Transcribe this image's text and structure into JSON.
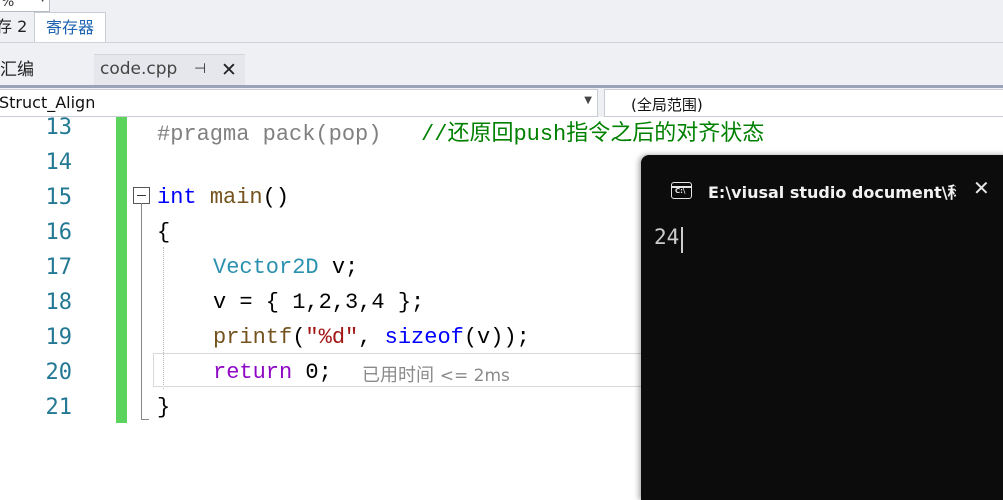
{
  "zoom": {
    "value": "%"
  },
  "window_tabs": [
    {
      "label": "存 2"
    },
    {
      "label": "寄存器"
    }
  ],
  "doc_tabs": {
    "left_label": "汇编",
    "active": {
      "name": "code.cpp",
      "pin_icon": "pin-icon",
      "close_icon": "close-icon"
    }
  },
  "navbar": {
    "scope_left": "Struct_Align",
    "scope_right": "(全局范围)"
  },
  "editor": {
    "line_numbers": [
      "13",
      "14",
      "15",
      "16",
      "17",
      "18",
      "19",
      "20",
      "21"
    ],
    "lines": {
      "l13": {
        "a": "#pragma pack(pop)",
        "b": "   //还原回push指令之后的对齐状态"
      },
      "l15": {
        "a": "int",
        "b": " ",
        "c": "main",
        "d": "()"
      },
      "l16": {
        "a": "{"
      },
      "l17": {
        "a": "Vector2D",
        "b": " v;"
      },
      "l18": {
        "a": "v = { 1,2,3,4 };"
      },
      "l19": {
        "a": "printf",
        "b": "(",
        "c": "\"%d\"",
        "d": ", ",
        "e": "sizeof",
        "f": "(v));"
      },
      "l20": {
        "a": "return",
        "b": " 0;"
      },
      "l21": {
        "a": "}"
      }
    },
    "perf_hint": {
      "text": "已用时间",
      "value": "<= 2ms"
    },
    "accent_color": "#5cd35c"
  },
  "console": {
    "title": "E:\\viusal studio document\\科研",
    "output": "24"
  }
}
